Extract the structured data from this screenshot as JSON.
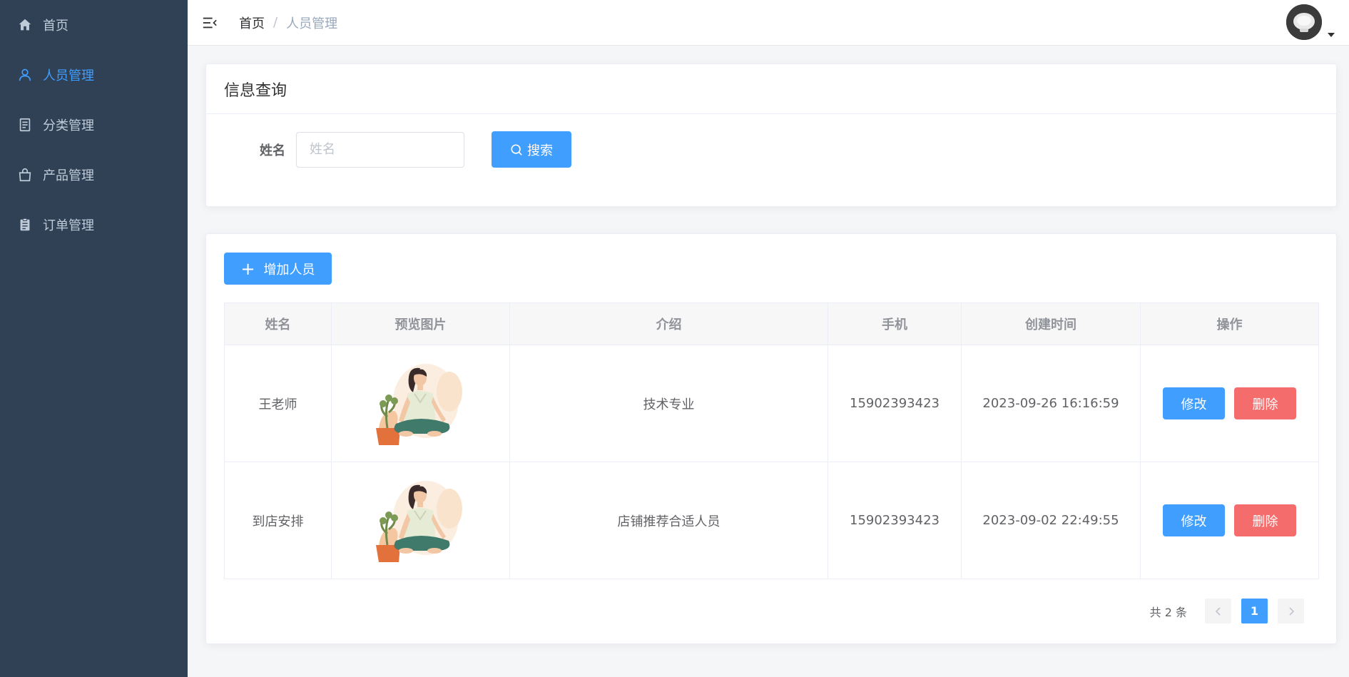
{
  "sidebar": {
    "items": [
      {
        "label": "首页",
        "icon": "home-icon",
        "active": false
      },
      {
        "label": "人员管理",
        "icon": "user-icon",
        "active": true
      },
      {
        "label": "分类管理",
        "icon": "document-icon",
        "active": false
      },
      {
        "label": "产品管理",
        "icon": "shopping-bag-icon",
        "active": false
      },
      {
        "label": "订单管理",
        "icon": "clipboard-icon",
        "active": false
      }
    ]
  },
  "header": {
    "breadcrumb": {
      "home": "首页",
      "separator": "/",
      "current": "人员管理"
    }
  },
  "query": {
    "title": "信息查询",
    "name_label": "姓名",
    "name_placeholder": "姓名",
    "name_value": "",
    "search_label": "搜索"
  },
  "table": {
    "add_label": "增加人员",
    "columns": [
      "姓名",
      "预览图片",
      "介绍",
      "手机",
      "创建时间",
      "操作"
    ],
    "rows": [
      {
        "name": "王老师",
        "intro": "技术专业",
        "phone": "15902393423",
        "created": "2023-09-26 16:16:59"
      },
      {
        "name": "到店安排",
        "intro": "店铺推荐合适人员",
        "phone": "15902393423",
        "created": "2023-09-02 22:49:55"
      }
    ],
    "edit_label": "修改",
    "delete_label": "删除"
  },
  "pagination": {
    "total_text": "共 2 条",
    "current_page": "1"
  },
  "colors": {
    "sidebar_bg": "#304156",
    "sidebar_text": "#bfcbd9",
    "accent": "#409eff",
    "danger": "#f56c6c"
  }
}
